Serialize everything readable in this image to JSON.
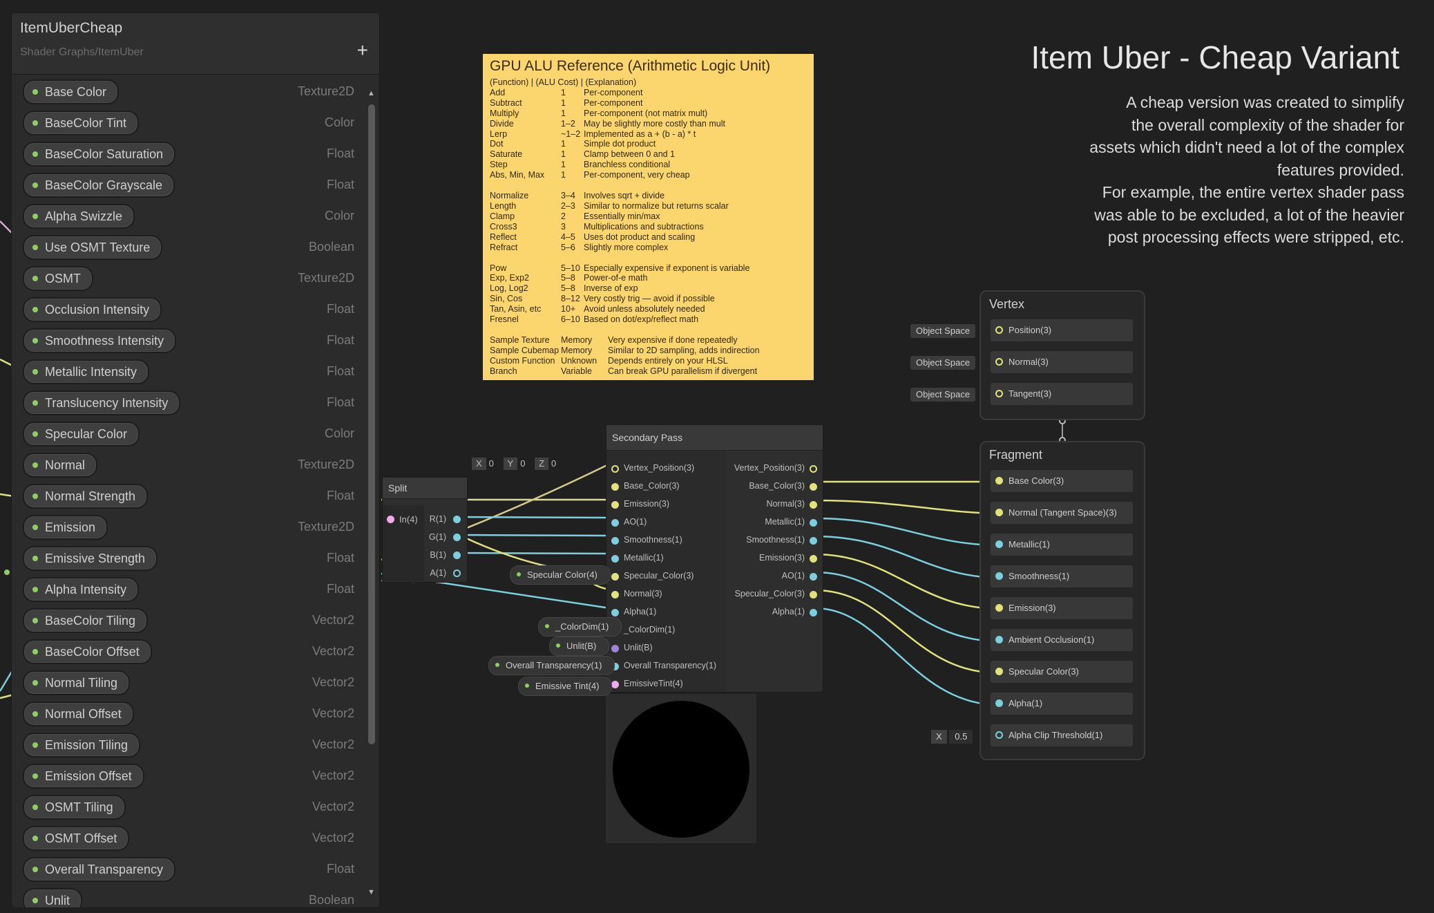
{
  "blackboard": {
    "title": "ItemUberCheap",
    "path": "Shader Graphs/ItemUber",
    "add_label": "+",
    "properties": [
      {
        "name": "Base Color",
        "type": "Texture2D"
      },
      {
        "name": "BaseColor Tint",
        "type": "Color"
      },
      {
        "name": "BaseColor Saturation",
        "type": "Float"
      },
      {
        "name": "BaseColor Grayscale",
        "type": "Float"
      },
      {
        "name": "Alpha Swizzle",
        "type": "Color"
      },
      {
        "name": "Use OSMT Texture",
        "type": "Boolean"
      },
      {
        "name": "OSMT",
        "type": "Texture2D"
      },
      {
        "name": "Occlusion Intensity",
        "type": "Float"
      },
      {
        "name": "Smoothness Intensity",
        "type": "Float"
      },
      {
        "name": "Metallic Intensity",
        "type": "Float"
      },
      {
        "name": "Translucency Intensity",
        "type": "Float"
      },
      {
        "name": "Specular Color",
        "type": "Color"
      },
      {
        "name": "Normal",
        "type": "Texture2D"
      },
      {
        "name": "Normal Strength",
        "type": "Float"
      },
      {
        "name": "Emission",
        "type": "Texture2D"
      },
      {
        "name": "Emissive Strength",
        "type": "Float"
      },
      {
        "name": "Alpha Intensity",
        "type": "Float"
      },
      {
        "name": "BaseColor Tiling",
        "type": "Vector2"
      },
      {
        "name": "BaseColor Offset",
        "type": "Vector2"
      },
      {
        "name": "Normal Tiling",
        "type": "Vector2"
      },
      {
        "name": "Normal Offset",
        "type": "Vector2"
      },
      {
        "name": "Emission Tiling",
        "type": "Vector2"
      },
      {
        "name": "Emission Offset",
        "type": "Vector2"
      },
      {
        "name": "OSMT Tiling",
        "type": "Vector2"
      },
      {
        "name": "OSMT Offset",
        "type": "Vector2"
      },
      {
        "name": "Overall Transparency",
        "type": "Float"
      },
      {
        "name": "Unlit",
        "type": "Boolean"
      }
    ]
  },
  "sticky": {
    "title": "GPU ALU Reference (Arithmetic Logic Unit)",
    "header": "(Function) | (ALU Cost) | (Explanation)",
    "groups": [
      [
        [
          "Add",
          "1",
          "Per-component"
        ],
        [
          "Subtract",
          "1",
          "Per-component"
        ],
        [
          "Multiply",
          "1",
          "Per-component (not matrix mult)"
        ],
        [
          "Divide",
          "1–2",
          "May be slightly more costly than mult"
        ],
        [
          "Lerp",
          "~1–2",
          "Implemented as a + (b - a) * t"
        ],
        [
          "Dot",
          "1",
          "Simple dot product"
        ],
        [
          "Saturate",
          "1",
          "Clamp between 0 and 1"
        ],
        [
          "Step",
          "1",
          "Branchless conditional"
        ],
        [
          "Abs, Min, Max",
          "1",
          "Per-component, very cheap"
        ]
      ],
      [
        [
          "Normalize",
          "3–4",
          "Involves sqrt + divide"
        ],
        [
          "Length",
          "2–3",
          "Similar to normalize but returns scalar"
        ],
        [
          "Clamp",
          "2",
          "Essentially min/max"
        ],
        [
          "Cross3",
          "3",
          "Multiplications and subtractions"
        ],
        [
          "Reflect",
          "4–5",
          "Uses dot product and scaling"
        ],
        [
          "Refract",
          "5–6",
          "Slightly more complex"
        ]
      ],
      [
        [
          "Pow",
          "5–10",
          "Especially expensive if exponent is variable"
        ],
        [
          "Exp, Exp2",
          "5–8",
          "Power-of-e math"
        ],
        [
          "Log, Log2",
          "5–8",
          "Inverse of exp"
        ],
        [
          "Sin, Cos",
          "8–12",
          "Very costly trig — avoid if possible"
        ],
        [
          "Tan, Asin, etc",
          "10+",
          "Avoid unless absolutely needed"
        ],
        [
          "Fresnel",
          "6–10",
          "Based on dot/exp/reflect math"
        ]
      ]
    ],
    "memory": [
      [
        "Sample Texture",
        "Memory",
        "Very expensive if done repeatedly"
      ],
      [
        "Sample Cubemap",
        "Memory",
        "Similar to 2D sampling, adds indirection"
      ],
      [
        "Custom Function",
        "Unknown",
        "Depends entirely on your HLSL"
      ],
      [
        "Branch",
        "Variable",
        "Can break GPU parallelism if divergent"
      ]
    ]
  },
  "doc": {
    "title": "Item Uber - Cheap Variant",
    "lines": [
      "A cheap version was created to simplify",
      "the overall complexity of the shader for",
      "assets which didn't need a lot of the complex",
      "features provided.",
      "For example, the entire vertex shader pass",
      "was able to be excluded, a lot of the heavier",
      "post processing effects were stripped, etc."
    ]
  },
  "split_node": {
    "title": "Split",
    "input": "In(4)",
    "outputs": [
      "R(1)",
      "G(1)",
      "B(1)",
      "A(1)"
    ]
  },
  "secondary_pass": {
    "title": "Secondary Pass",
    "vec": {
      "x_label": "X",
      "x": "0",
      "y_label": "Y",
      "y": "0",
      "z_label": "Z",
      "z": "0"
    },
    "inputs": [
      "Vertex_Position(3)",
      "Base_Color(3)",
      "Emission(3)",
      "AO(1)",
      "Smoothness(1)",
      "Metallic(1)",
      "Specular_Color(3)",
      "Normal(3)",
      "Alpha(1)",
      "_ColorDim(1)",
      "Unlit(B)",
      "Overall Transparency(1)",
      "EmissiveTint(4)"
    ],
    "outputs": [
      "Vertex_Position(3)",
      "Base_Color(3)",
      "Normal(3)",
      "Metallic(1)",
      "Smoothness(1)",
      "Emission(3)",
      "AO(1)",
      "Specular_Color(3)",
      "Alpha(1)"
    ]
  },
  "floating_props": [
    {
      "label": "Specular Color(4)"
    },
    {
      "label": "_ColorDim(1)"
    },
    {
      "label": "Unlit(B)"
    },
    {
      "label": "Overall Transparency(1)"
    },
    {
      "label": "Emissive Tint(4)"
    }
  ],
  "vertex": {
    "title": "Vertex",
    "space_label": "Object Space",
    "blocks": [
      "Position(3)",
      "Normal(3)",
      "Tangent(3)"
    ]
  },
  "fragment": {
    "title": "Fragment",
    "blocks": [
      "Base Color(3)",
      "Normal (Tangent Space)(3)",
      "Metallic(1)",
      "Smoothness(1)",
      "Emission(3)",
      "Ambient Occlusion(1)",
      "Specular Color(3)",
      "Alpha(1)",
      "Alpha Clip Threshold(1)"
    ],
    "alpha_clip": {
      "axis": "X",
      "value": "0.5"
    }
  },
  "colors": {
    "background": "#202020",
    "vector3": "#e2e27a",
    "float": "#7ad0df",
    "vector4": "#f0a8ef",
    "boolean": "#9f82e0",
    "sticky": "#fbd66e",
    "property_dot": "#8fcf62"
  }
}
